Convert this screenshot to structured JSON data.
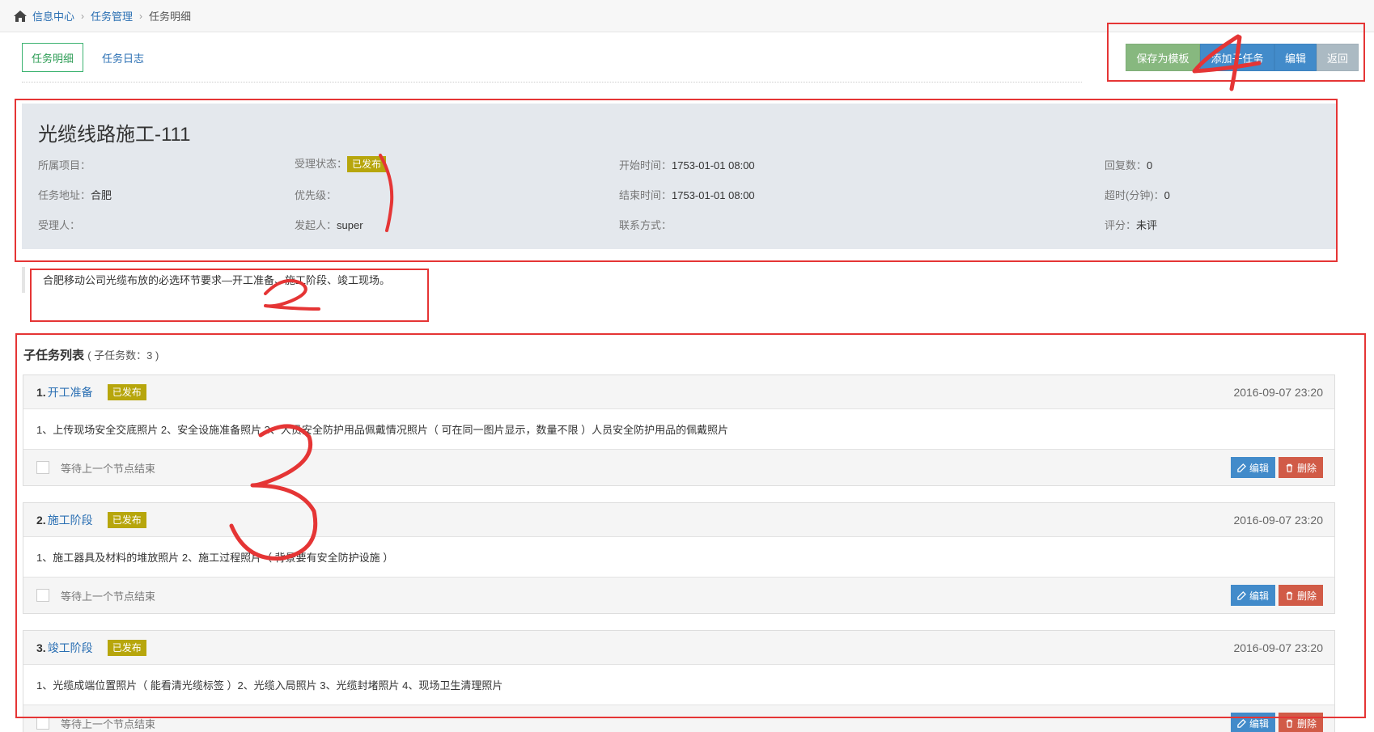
{
  "breadcrumb": {
    "home": "信息中心",
    "level2": "任务管理",
    "current": "任务明细"
  },
  "tabs": [
    {
      "label": "任务明细"
    },
    {
      "label": "任务日志"
    }
  ],
  "actions": {
    "save_template": "保存为模板",
    "add_subtask": "添加子任务",
    "edit": "编辑",
    "back": "返回"
  },
  "task": {
    "title": "光缆线路施工-111",
    "project_label": "所属项目：",
    "project_value": "",
    "status_label": "受理状态：",
    "status_value": "已发布",
    "start_label": "开始时间：",
    "start_value": "1753-01-01 08:00",
    "reply_label": "回复数：",
    "reply_value": "0",
    "address_label": "任务地址：",
    "address_value": "合肥",
    "priority_label": "优先级：",
    "priority_value": "",
    "end_label": "结束时间：",
    "end_value": "1753-01-01 08:00",
    "overtime_label": "超时(分钟)：",
    "overtime_value": "0",
    "assignee_label": "受理人：",
    "assignee_value": "",
    "initiator_label": "发起人：",
    "initiator_value": "super",
    "contact_label": "联系方式：",
    "contact_value": "",
    "rating_label": "评分：",
    "rating_value": "未评"
  },
  "description": "合肥移动公司光缆布放的必选环节要求—开工准备、施工阶段、竣工现场。",
  "subtasks_header": {
    "title": "子任务列表",
    "count_text": "( 子任务数：3 )"
  },
  "subtasks": [
    {
      "num": "1.",
      "name": "开工准备",
      "status": "已发布",
      "date": "2016-09-07 23:20",
      "content": "1、上传现场安全交底照片 2、安全设施准备照片 3、人员安全防护用品佩戴情况照片（ 可在同一图片显示，数量不限 ）人员安全防护用品的佩戴照片",
      "wait": "等待上一个节点结束",
      "edit": "编辑",
      "delete": "删除"
    },
    {
      "num": "2.",
      "name": "施工阶段",
      "status": "已发布",
      "date": "2016-09-07 23:20",
      "content": "1、施工器具及材料的堆放照片 2、施工过程照片（ 背景要有安全防护设施 ）",
      "wait": "等待上一个节点结束",
      "edit": "编辑",
      "delete": "删除"
    },
    {
      "num": "3.",
      "name": "竣工阶段",
      "status": "已发布",
      "date": "2016-09-07 23:20",
      "content": "1、光缆成端位置照片（ 能看清光缆标签 ）2、光缆入局照片 3、光缆封堵照片 4、现场卫生清理照片",
      "wait": "等待上一个节点结束",
      "edit": "编辑",
      "delete": "删除"
    }
  ],
  "colors": {
    "accent_blue": "#428bca",
    "save_green": "#87b87f",
    "back_grey": "#abbac3",
    "delete_red": "#d15b47",
    "badge": "#b7a60c",
    "annotation": "#e53535"
  },
  "annotations": [
    "1",
    "2",
    "3",
    "4"
  ]
}
